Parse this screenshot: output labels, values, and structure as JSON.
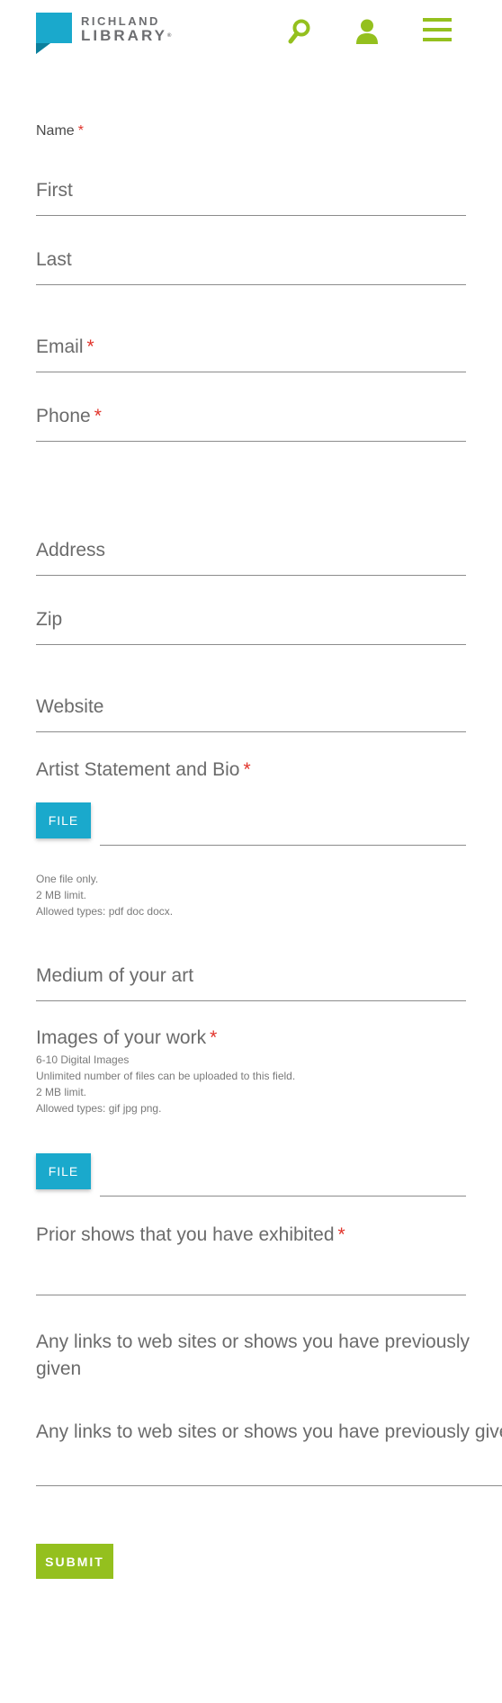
{
  "header": {
    "logo_line1": "RICHLAND",
    "logo_line2": "LIBRARY",
    "logo_reg": "®",
    "brand_teal": "#1aa9cc",
    "brand_green": "#94c01e",
    "icons": [
      "search-icon",
      "user-icon",
      "menu-icon"
    ]
  },
  "form": {
    "name_label": "Name",
    "required_mark": "*",
    "first_placeholder": "First",
    "last_placeholder": "Last",
    "email_label": "Email",
    "phone_label": "Phone",
    "address_placeholder": "Address",
    "zip_placeholder": "Zip",
    "website_placeholder": "Website",
    "artist_statement_label": "Artist Statement and Bio",
    "file_button": "FILE",
    "artist_help": [
      "One file only.",
      "2 MB limit.",
      "Allowed types: pdf doc docx."
    ],
    "medium_placeholder": "Medium of your art",
    "images_label": "Images of your work",
    "images_help": [
      "6-10 Digital Images",
      "Unlimited number of files can be uploaded to this field.",
      "2 MB limit.",
      "Allowed types: gif jpg png."
    ],
    "prior_shows_label": "Prior shows that you have exhibited",
    "links_label_line1": "Any links to web sites or shows you have previously",
    "links_label_line2": "given",
    "links_placeholder": "Any links to web sites or shows you have previously given",
    "submit_label": "SUBMIT"
  }
}
